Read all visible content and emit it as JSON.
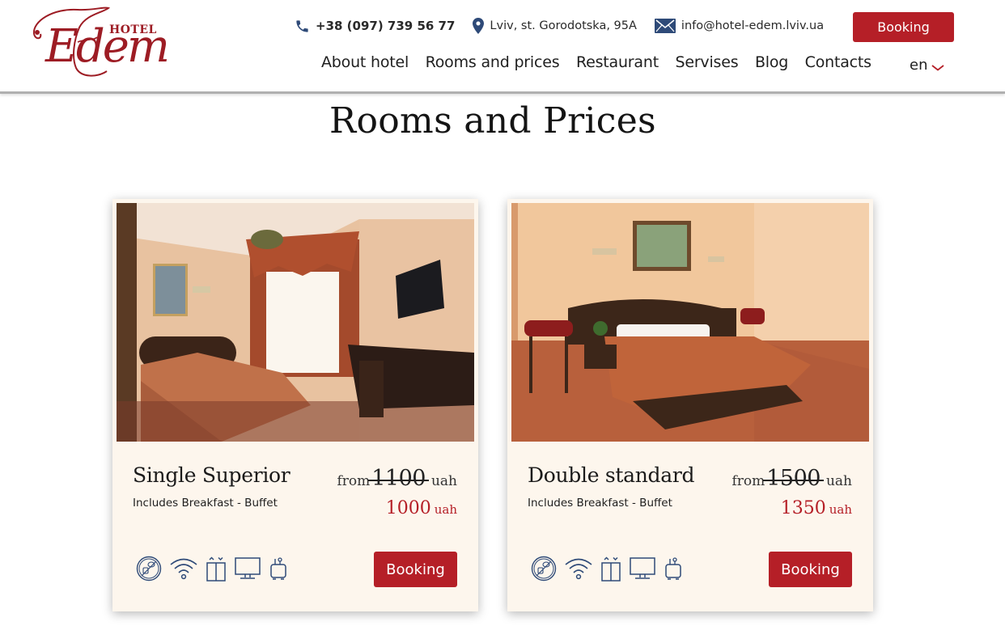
{
  "brand": {
    "logo_small": "HOTEL",
    "logo_main": "Edem",
    "color_primary": "#b51f27",
    "color_logo": "#9d1c24",
    "color_icons": "#2e4a78"
  },
  "header": {
    "phone": "+38 (097) 739 56 77",
    "address": "Lviv, st. Gorodotska, 95A",
    "email": "info@hotel-edem.lviv.ua",
    "booking_label": "Booking",
    "icons": {
      "phone": "phone-icon",
      "address": "map-pin-icon",
      "email": "envelope-icon"
    }
  },
  "nav": {
    "items": [
      {
        "label": "About hotel"
      },
      {
        "label": "Rooms and prices"
      },
      {
        "label": "Restaurant"
      },
      {
        "label": "Servises"
      },
      {
        "label": "Blog"
      },
      {
        "label": "Contacts"
      }
    ],
    "language": "en"
  },
  "page": {
    "title": "Rooms and Prices"
  },
  "rooms": [
    {
      "name": "Single Superior",
      "subtitle": "Includes Breakfast - Buffet",
      "from_label": "from",
      "old_price": "1100",
      "new_price": "1000",
      "currency": "uah",
      "booking_label": "Booking",
      "photo": "single-room-photo",
      "amenities": [
        "breakfast-icon",
        "wifi-icon",
        "elevator-icon",
        "tv-icon",
        "kettle-icon"
      ]
    },
    {
      "name": "Double standard",
      "subtitle": "Includes Breakfast - Buffet",
      "from_label": "from",
      "old_price": "1500",
      "new_price": "1350",
      "currency": "uah",
      "booking_label": "Booking",
      "photo": "double-room-photo",
      "amenities": [
        "breakfast-icon",
        "wifi-icon",
        "elevator-icon",
        "tv-icon",
        "kettle-icon"
      ]
    }
  ]
}
